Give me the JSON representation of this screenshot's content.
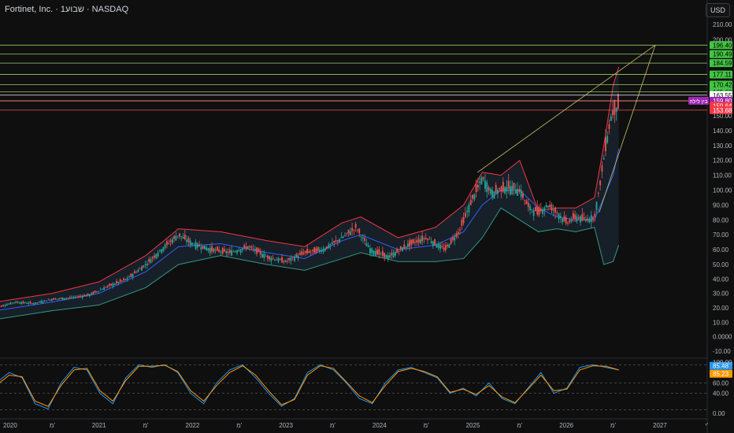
{
  "header": {
    "symbol_line": "Fortinet, Inc. · 1שבוע · NASDAQ",
    "currency_button": "USD"
  },
  "colors": {
    "background": "#0f0f0f",
    "candle_up": "#26a69a",
    "candle_down": "#ef5350",
    "bb_upper": "#f23645",
    "bb_lower": "#2e9c81",
    "bb_basis": "#2962ff",
    "bb_fill": "#1b2733",
    "fib_level": "#9ccc65",
    "rsi_k": "#2196f3",
    "rsi_d": "#ff9800",
    "night_tag": "#9c27b0"
  },
  "chart_data": [
    {
      "type": "candlestick",
      "ticker": "Fortinet, Inc.",
      "interval": "1שבוע",
      "exchange": "NASDAQ",
      "currency": "USD",
      "y_axis_ticks": [
        "210.00",
        "200.00",
        "150.00",
        "140.00",
        "130.00",
        "120.00",
        "110.00",
        "100.00",
        "90.00",
        "80.00",
        "70.00",
        "60.00",
        "50.00",
        "40.00",
        "30.00",
        "20.00",
        "10.00",
        "0.0000",
        "-10.00"
      ],
      "x_axis_ticks": [
        "2020",
        "מ'",
        "2021",
        "מ'",
        "2022",
        "מ'",
        "2023",
        "מ'",
        "2024",
        "מ'",
        "2025",
        "מ'",
        "2026",
        "מ'",
        "2027",
        "י'"
      ],
      "series_close": {
        "years": [
          2019.9,
          2020.1,
          2020.3,
          2020.5,
          2020.7,
          2020.9,
          2021.1,
          2021.3,
          2021.5,
          2021.7,
          2021.85,
          2022.0,
          2022.2,
          2022.4,
          2022.6,
          2022.8,
          2023.0,
          2023.2,
          2023.4,
          2023.6,
          2023.75,
          2023.9,
          2024.1,
          2024.3,
          2024.5,
          2024.7,
          2024.85,
          2025.0,
          2025.1,
          2025.2,
          2025.35,
          2025.5,
          2025.6,
          2025.7,
          2025.8,
          2025.9,
          2026.0,
          2026.1,
          2026.2,
          2026.3,
          2026.35,
          2026.42,
          2026.48,
          2026.52,
          2026.56
        ],
        "close": [
          20,
          24,
          23,
          26,
          27,
          29,
          35,
          40,
          50,
          62,
          70,
          64,
          60,
          58,
          62,
          55,
          52,
          58,
          60,
          68,
          75,
          60,
          55,
          63,
          68,
          60,
          72,
          95,
          108,
          98,
          102,
          100,
          88,
          85,
          90,
          85,
          78,
          82,
          80,
          82,
          100,
          130,
          150,
          155,
          158
        ]
      },
      "bollinger_upper": {
        "years": [
          2019.9,
          2020.5,
          2021.0,
          2021.5,
          2021.85,
          2022.3,
          2022.8,
          2023.2,
          2023.6,
          2023.8,
          2024.2,
          2024.6,
          2024.9,
          2025.1,
          2025.3,
          2025.5,
          2025.7,
          2025.9,
          2026.1,
          2026.3,
          2026.4,
          2026.5,
          2026.56
        ],
        "values": [
          24,
          30,
          38,
          56,
          74,
          72,
          66,
          62,
          78,
          82,
          68,
          75,
          90,
          112,
          110,
          120,
          86,
          88,
          88,
          95,
          130,
          170,
          182
        ]
      },
      "bollinger_basis": {
        "years": [
          2019.9,
          2020.5,
          2021.0,
          2021.5,
          2021.85,
          2022.3,
          2022.8,
          2023.2,
          2023.6,
          2023.8,
          2024.2,
          2024.6,
          2024.9,
          2025.1,
          2025.3,
          2025.5,
          2025.7,
          2025.9,
          2026.1,
          2026.3,
          2026.4,
          2026.5,
          2026.56
        ],
        "values": [
          18,
          24,
          30,
          45,
          62,
          64,
          58,
          54,
          66,
          70,
          60,
          63,
          72,
          90,
          100,
          100,
          88,
          82,
          80,
          80,
          95,
          110,
          128
        ]
      },
      "bollinger_lower": {
        "years": [
          2019.9,
          2020.5,
          2021.0,
          2021.5,
          2021.85,
          2022.3,
          2022.8,
          2023.2,
          2023.6,
          2023.8,
          2024.2,
          2024.6,
          2024.9,
          2025.1,
          2025.3,
          2025.5,
          2025.7,
          2025.9,
          2026.1,
          2026.3,
          2026.4,
          2026.5,
          2026.56
        ],
        "values": [
          12,
          18,
          22,
          34,
          50,
          56,
          50,
          46,
          54,
          58,
          52,
          52,
          54,
          68,
          88,
          80,
          72,
          74,
          72,
          75,
          50,
          52,
          63
        ]
      },
      "trendlines": [
        {
          "from": [
            2025.05,
            112
          ],
          "to": [
            2026.95,
            196.4
          ]
        },
        {
          "from": [
            2026.35,
            85
          ],
          "to": [
            2026.95,
            196.4
          ]
        }
      ],
      "horizontal_levels": [
        {
          "value": 196.4,
          "label": "196.40",
          "kind": "fib"
        },
        {
          "value": 190.49,
          "label": "190.49",
          "kind": "fib"
        },
        {
          "value": 184.59,
          "label": "184.59",
          "kind": "fib"
        },
        {
          "value": 177.11,
          "label": "177.11",
          "kind": "fib"
        },
        {
          "value": 170.42,
          "label": "170.42",
          "kind": "fib"
        },
        {
          "value": 165.63,
          "label": "165.63",
          "kind": "fib"
        },
        {
          "value": 163.55,
          "label": "163.55",
          "kind": "current"
        },
        {
          "value": 159.8,
          "label": "159.80",
          "kind": "after-hours"
        },
        {
          "value": 159.64,
          "label": "159.64",
          "kind": "down"
        },
        {
          "value": 153.68,
          "label": "153.68",
          "kind": "red-level"
        }
      ],
      "after_hours_tag": "בין לילה"
    },
    {
      "type": "line",
      "indicator": "Stochastic RSI",
      "y_axis_ticks": [
        "100.00",
        "60.00",
        "40.00",
        "0.00"
      ],
      "series": [
        {
          "name": "K",
          "last": "85.48",
          "values": [
            60,
            80,
            70,
            20,
            10,
            60,
            90,
            85,
            40,
            20,
            70,
            95,
            90,
            95,
            80,
            40,
            20,
            60,
            85,
            95,
            70,
            40,
            15,
            30,
            80,
            95,
            85,
            60,
            30,
            20,
            60,
            85,
            90,
            80,
            70,
            40,
            50,
            35,
            60,
            30,
            20,
            50,
            80,
            40,
            50,
            90,
            95,
            90,
            85
          ]
        },
        {
          "name": "D",
          "last": "85.23",
          "values": [
            55,
            75,
            72,
            25,
            15,
            55,
            85,
            88,
            45,
            25,
            65,
            92,
            92,
            94,
            82,
            45,
            25,
            55,
            80,
            93,
            75,
            45,
            18,
            28,
            75,
            93,
            88,
            62,
            35,
            22,
            55,
            82,
            88,
            82,
            72,
            42,
            48,
            38,
            55,
            33,
            22,
            48,
            75,
            45,
            48,
            85,
            93,
            92,
            85
          ]
        }
      ]
    }
  ]
}
